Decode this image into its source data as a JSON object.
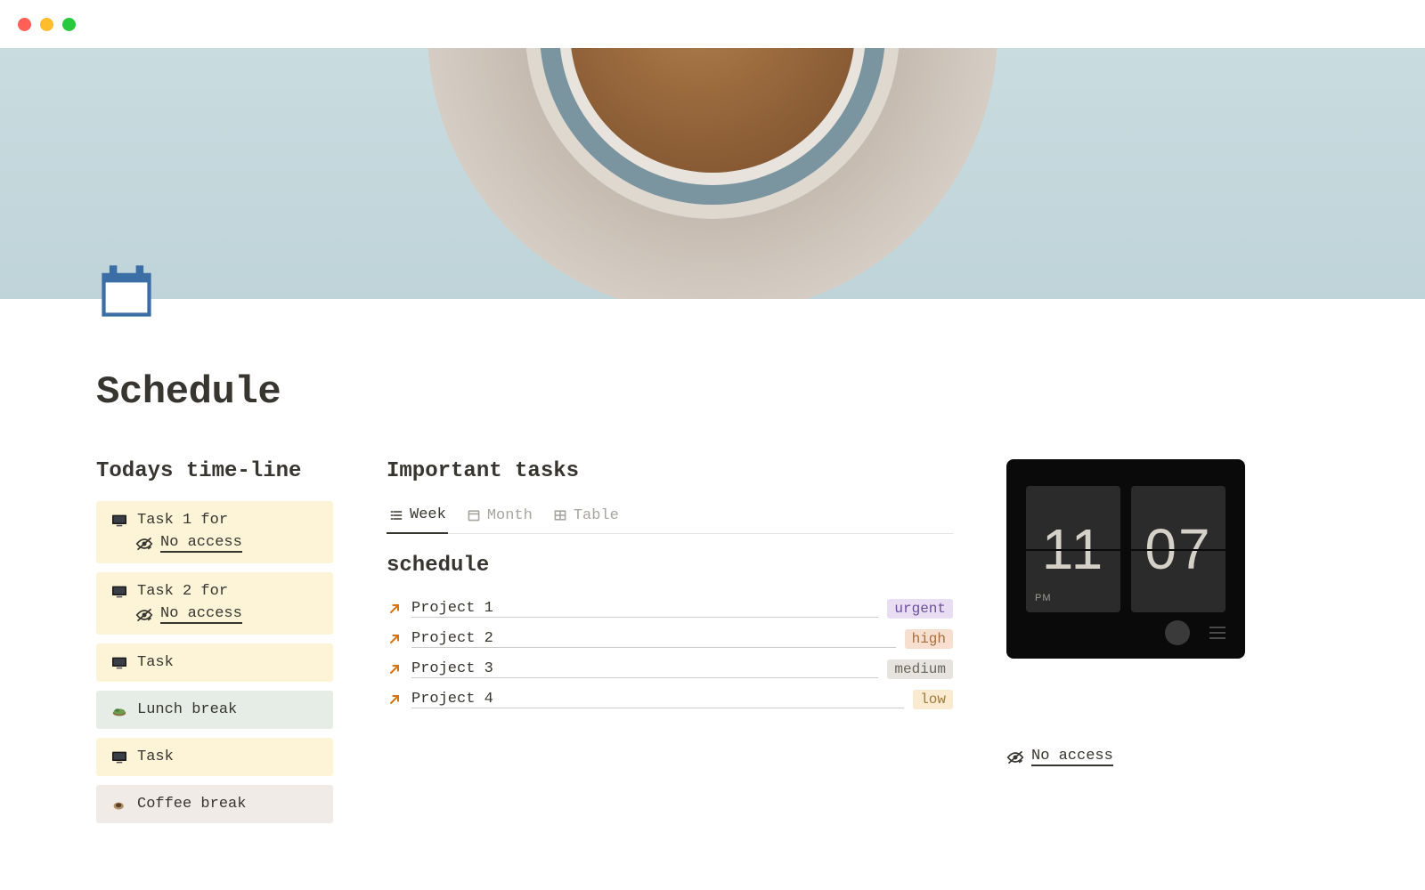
{
  "page": {
    "title": "Schedule"
  },
  "timeline": {
    "heading": "Todays time-line",
    "no_access_label": "No access",
    "items": [
      {
        "label": "Task 1 for",
        "variant": "yellow",
        "show_no_access": true,
        "icon": "computer"
      },
      {
        "label": "Task 2 for",
        "variant": "yellow",
        "show_no_access": true,
        "icon": "computer"
      },
      {
        "label": "Task",
        "variant": "yellow",
        "show_no_access": false,
        "icon": "computer"
      },
      {
        "label": "Lunch break",
        "variant": "green",
        "show_no_access": false,
        "icon": "salad"
      },
      {
        "label": "Task",
        "variant": "yellow",
        "show_no_access": false,
        "icon": "computer"
      },
      {
        "label": "Coffee break",
        "variant": "brown",
        "show_no_access": false,
        "icon": "coffee"
      }
    ]
  },
  "important_tasks": {
    "heading": "Important tasks",
    "tabs": [
      {
        "label": "Week",
        "active": true
      },
      {
        "label": "Month",
        "active": false
      },
      {
        "label": "Table",
        "active": false
      }
    ],
    "schedule_title": "schedule",
    "projects": [
      {
        "name": "Project 1",
        "priority": "urgent"
      },
      {
        "name": "Project 2",
        "priority": "high"
      },
      {
        "name": "Project 3",
        "priority": "medium"
      },
      {
        "name": "Project 4",
        "priority": "low"
      }
    ],
    "priority_labels": {
      "urgent": "urgent",
      "high": "high",
      "medium": "medium",
      "low": "low"
    }
  },
  "clock": {
    "hours": "11",
    "minutes": "07",
    "ampm": "PM"
  },
  "right_no_access": "No access"
}
